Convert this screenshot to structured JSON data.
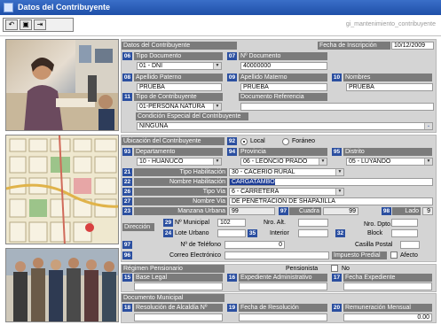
{
  "window": {
    "title": "Datos del Contribuyente"
  },
  "toolbar": {
    "form_name": "gi_mantenimiento_contribuyente",
    "btn_undo": "↶",
    "btn_save": "▣",
    "btn_exit": "⇥"
  },
  "datos": {
    "header": "Datos del Contribuyente",
    "fecha_inscripcion_label": "Fecha de Inscripción",
    "fecha_inscripcion": "10/12/2009",
    "tipo_documento": {
      "num": "06",
      "label": "Tipo Documento",
      "value": "01 - DNI"
    },
    "nro_documento": {
      "num": "07",
      "label": "Nº Documento",
      "value": "40000000"
    },
    "apellido_paterno": {
      "num": "08",
      "label": "Apellido Paterno",
      "value": "PRUEBA"
    },
    "apellido_materno": {
      "num": "09",
      "label": "Apellido Materno",
      "value": "PRUEBA"
    },
    "nombres": {
      "num": "10",
      "label": "Nombres",
      "value": "PRUEBA"
    },
    "tipo_contribuyente": {
      "num": "11",
      "label": "Tipo de Contribuyente",
      "value": "01-PERSONA NATURA"
    },
    "documento_referencia": {
      "label": "Documento Referencia",
      "value": ""
    },
    "condicion_especial": {
      "label": "Condición Especial del Contribuyente",
      "value": "NINGUNA"
    }
  },
  "ubicacion": {
    "header": "Ubicación del Contribuyente",
    "radio_num": "92",
    "local_label": "Local",
    "foraneo_label": "Foráneo",
    "departamento": {
      "num": "93",
      "label": "Departamento",
      "value": "10 - HUANUCO"
    },
    "provincia": {
      "num": "94",
      "label": "Provincia",
      "value": "06 - LEONCIO PRADO"
    },
    "distrito": {
      "num": "95",
      "label": "Distrito",
      "value": "05 - LUYANDO"
    },
    "tipo_habilitacion": {
      "num": "21",
      "label": "Tipo Habilitación",
      "value": "30 - CACERIO RURAL"
    },
    "nombre_habilitacion": {
      "num": "22",
      "label": "Nombre Habilitación",
      "value": "CARGATAMBO"
    },
    "tipo_via": {
      "num": "26",
      "label": "Tipo Via",
      "value": "6 - CARRETERA"
    },
    "nombre_via": {
      "num": "27",
      "label": "Nombre Via",
      "value": "DE PENETRACION DE SHAPAJILLA"
    },
    "manzana": {
      "num": "23",
      "label": "Manzana Urbana",
      "value": "99"
    },
    "cuadra": {
      "num": "97",
      "label": "Cuadra",
      "value": "99"
    },
    "lado": {
      "num": "98",
      "label": "Lado",
      "value": "9"
    },
    "direccion_label": "Dirección",
    "nro_municipal": {
      "num": "29",
      "label": "Nº Municipal",
      "value": "102"
    },
    "nro_alt": {
      "label": "Nro. Alt.",
      "value": ""
    },
    "nro_dpto": {
      "label": "Nro. Dpto.",
      "value": ""
    },
    "lote_urbano": {
      "num": "24",
      "label": "Lote Urbano",
      "value": ""
    },
    "interior": {
      "num": "35",
      "label": "Interior",
      "value": ""
    },
    "block": {
      "num": "32",
      "label": "Block",
      "value": ""
    },
    "telefono": {
      "num": "97",
      "label": "Nº de Teléfono",
      "value": "0"
    },
    "casilla_postal": {
      "label": "Casilla Postal",
      "value": ""
    },
    "correo": {
      "num": "96",
      "label": "Correo Electrónico",
      "value": ""
    },
    "impuesto_predial_label": "Impuesto Predial",
    "afecto_label": "Afecto"
  },
  "regimen": {
    "header": "Régimen Pensionario",
    "pensionista_label": "Pensionista",
    "no_label": "No",
    "base_legal": {
      "num": "15",
      "label": "Base Legal",
      "value": ""
    },
    "expediente": {
      "num": "16",
      "label": "Expediente Administrativo",
      "value": ""
    },
    "fecha_expediente": {
      "num": "17",
      "label": "Fecha Expediente",
      "value": ""
    }
  },
  "municipal": {
    "header": "Documento Municipal",
    "resolucion": {
      "num": "18",
      "label": "Resolución de Alcaldía Nº",
      "value": ""
    },
    "fecha_resolucion": {
      "num": "19",
      "label": "Fecha de Resolución",
      "value": ""
    },
    "remuneracion": {
      "num": "20",
      "label": "Remuneración Mensual",
      "value": "0.00"
    }
  },
  "colors": {
    "title": "#1f4fa8",
    "label_bg": "#7b7b7b",
    "num_bg": "#2b4fa0",
    "panel": "#d4d4d4"
  }
}
